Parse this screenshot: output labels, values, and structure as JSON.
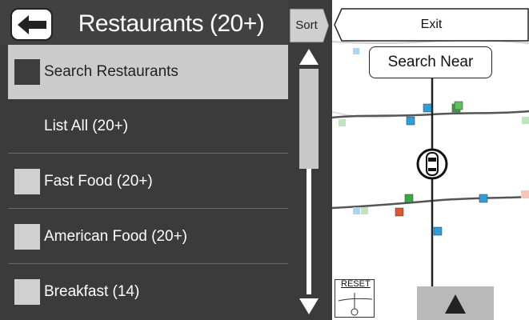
{
  "header": {
    "title": "Restaurants (20+)",
    "sort_label": "Sort",
    "back_icon": "back-arrow-icon"
  },
  "list": {
    "items": [
      {
        "label": "Search Restaurants",
        "selected": true
      },
      {
        "label": "List All (20+)",
        "selected": false,
        "checkbox": false
      },
      {
        "label": "Fast Food (20+)",
        "selected": false,
        "checkbox": true
      },
      {
        "label": "American Food (20+)",
        "selected": false,
        "checkbox": true
      },
      {
        "label": "Breakfast (14)",
        "selected": false,
        "checkbox": true
      }
    ]
  },
  "map": {
    "exit_label": "Exit",
    "search_near_label": "Search Near",
    "reset_label": "RESET"
  },
  "colors": {
    "panel_bg": "#3b3b3b",
    "selected_bg": "#cccccc",
    "poi_blue": "#2e9fd9",
    "poi_green": "#3aa845",
    "poi_red": "#e0572f"
  }
}
